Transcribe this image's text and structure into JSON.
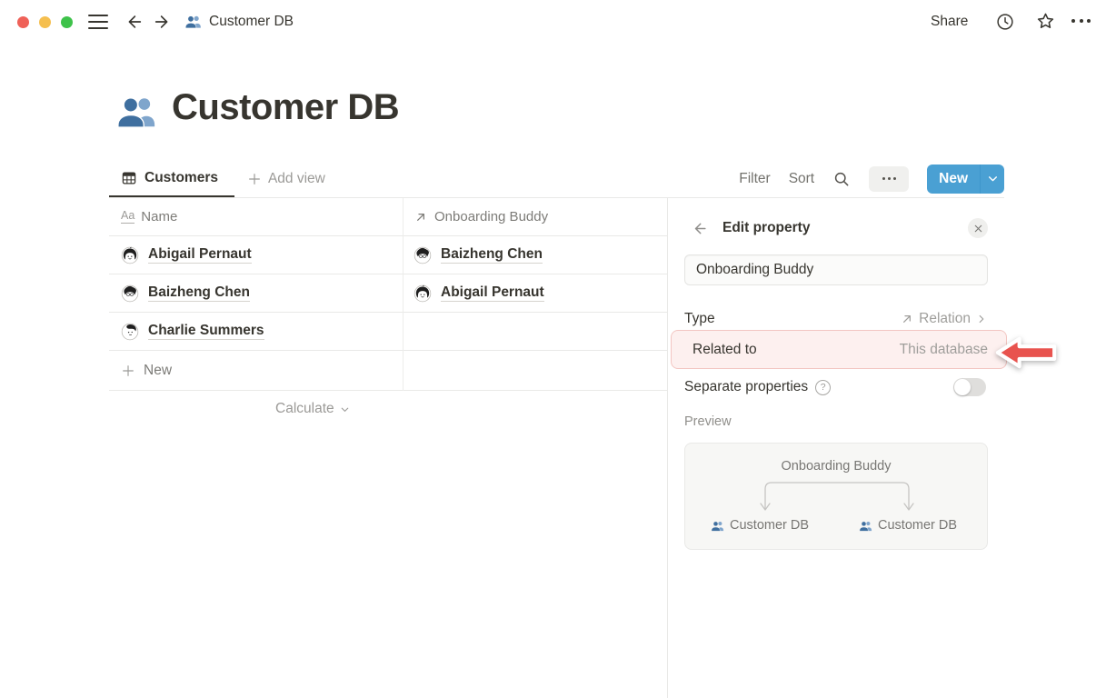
{
  "titlebar": {
    "breadcrumb": "Customer DB",
    "share": "Share"
  },
  "page": {
    "title": "Customer DB"
  },
  "viewbar": {
    "tab": "Customers",
    "add_view": "Add view",
    "filter": "Filter",
    "sort": "Sort",
    "new": "New"
  },
  "table": {
    "columns": {
      "name": "Name",
      "buddy": "Onboarding Buddy"
    },
    "rows": [
      {
        "name": "Abigail Pernaut",
        "buddy": "Baizheng Chen"
      },
      {
        "name": "Baizheng Chen",
        "buddy": "Abigail Pernaut"
      },
      {
        "name": "Charlie Summers",
        "buddy": ""
      }
    ],
    "new_row": "New",
    "calculate": "Calculate"
  },
  "panel": {
    "title": "Edit property",
    "name_input": "Onboarding Buddy",
    "type_label": "Type",
    "type_value": "Relation",
    "related_label": "Related to",
    "related_value": "This database",
    "separate_label": "Separate properties",
    "preview_label": "Preview",
    "preview": {
      "property": "Onboarding Buddy",
      "left": "Customer DB",
      "right": "Customer DB"
    }
  },
  "icons": {
    "title_icon_text": "Aa",
    "help_glyph": "?"
  },
  "colors": {
    "accent_blue": "#4aa0d3",
    "highlight_bg": "#fdf0ef",
    "highlight_border": "#f3c6c2",
    "annotation_red": "#e8534e",
    "people_icon_front": "#3f6f9f",
    "people_icon_back": "#7fa5cc",
    "traffic_red": "#ef6158",
    "traffic_yellow": "#f5bf4f",
    "traffic_green": "#3ec24a"
  }
}
